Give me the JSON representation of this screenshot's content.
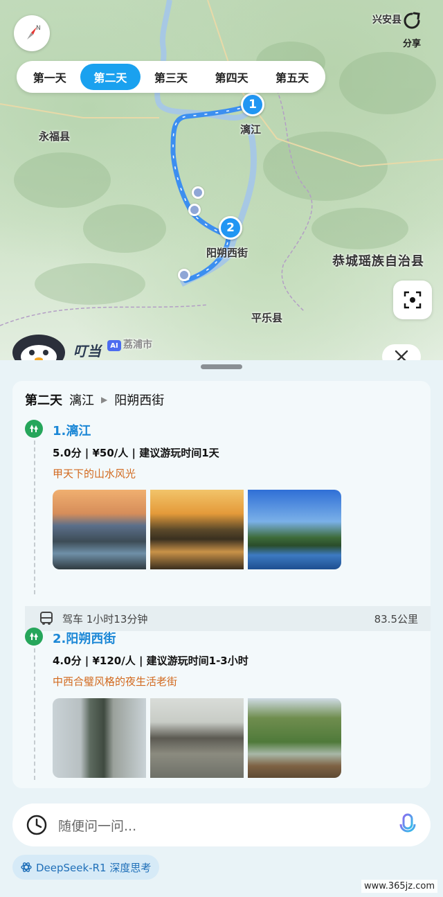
{
  "map": {
    "labels": {
      "xingan": "兴安县",
      "yongfu": "永福县",
      "lijiang": "漓江",
      "yangshuo": "阳朔西街",
      "gongcheng": "恭城瑶族自治县",
      "pingle": "平乐县",
      "lipu": "荔浦市"
    },
    "pins": [
      "1",
      "2"
    ],
    "share_label": "分享"
  },
  "day_tabs": [
    "第一天",
    "第二天",
    "第三天",
    "第四天",
    "第五天"
  ],
  "active_tab_index": 1,
  "assistant": {
    "name": "叮当",
    "badge": "AI"
  },
  "itinerary": {
    "day": "第二天",
    "from": "漓江",
    "to": "阳朔西街",
    "pois": [
      {
        "name": "1.漓江",
        "meta": "5.0分 | ¥50/人 | 建议游玩时间1天",
        "desc": "甲天下的山水风光"
      },
      {
        "name": "2.阳朔西街",
        "meta": "4.0分 | ¥120/人 | 建议游玩时间1-3小时",
        "desc": "中西合璧风格的夜生活老街"
      }
    ],
    "drive": {
      "mode": "驾车  1小时13分钟",
      "distance": "83.5公里"
    }
  },
  "ask": {
    "placeholder": "随便问一问..."
  },
  "model_chip": "DeepSeek-R1 深度思考",
  "watermark": "www.365jz.com",
  "colors": {
    "accent": "#1aa1ef",
    "poi_name": "#1b87d6",
    "desc": "#d2691e",
    "poi_icon": "#26a65b"
  }
}
